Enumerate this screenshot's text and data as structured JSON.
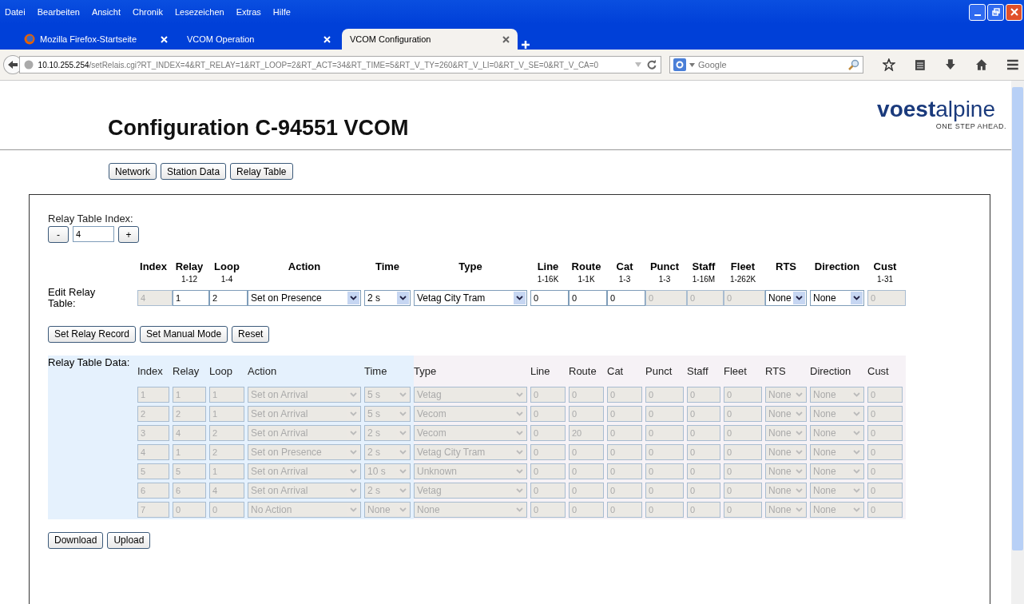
{
  "menu_bar": [
    "Datei",
    "Bearbeiten",
    "Ansicht",
    "Chronik",
    "Lesezeichen",
    "Extras",
    "Hilfe"
  ],
  "tabs": [
    {
      "label": "Mozilla Firefox-Startseite",
      "selected": false,
      "kind": "firefox"
    },
    {
      "label": "VCOM Operation",
      "selected": false,
      "kind": "plain"
    },
    {
      "label": "VCOM Configuration",
      "selected": true,
      "kind": "plain"
    }
  ],
  "address_bar": {
    "host": "10.10.255.254",
    "path": "/setRelais.cgi?RT_INDEX=4&RT_RELAY=1&RT_LOOP=2&RT_ACT=34&RT_TIME=5&RT_V_TY=260&RT_V_LI=0&RT_V_SE=0&RT_V_CA=0"
  },
  "search": {
    "placeholder": "Google"
  },
  "page": {
    "title": "Configuration C-94551 VCOM",
    "logo": {
      "name_bold_part": "voest",
      "name_rest": "alpine",
      "slogan": "ONE STEP AHEAD."
    },
    "nav_buttons": [
      "Network",
      "Station Data",
      "Relay Table"
    ],
    "index_label": "Relay Table Index:",
    "index_minus": "-",
    "index_value": "4",
    "index_plus": "+",
    "columns": [
      {
        "header": "Index",
        "kind": "text"
      },
      {
        "header": "Relay",
        "range": "1-12",
        "kind": "text"
      },
      {
        "header": "Loop",
        "range": "1-4",
        "kind": "text"
      },
      {
        "header": "Action",
        "kind": "select"
      },
      {
        "header": "Time",
        "kind": "select"
      },
      {
        "header": "Type",
        "kind": "select"
      },
      {
        "header": "Line",
        "range": "1-16K",
        "kind": "text"
      },
      {
        "header": "Route",
        "range": "1-1K",
        "kind": "text"
      },
      {
        "header": "Cat",
        "range": "1-3",
        "kind": "text"
      },
      {
        "header": "Punct",
        "range": "1-3",
        "kind": "text"
      },
      {
        "header": "Staff",
        "range": "1-16M",
        "kind": "text"
      },
      {
        "header": "Fleet",
        "range": "1-262K",
        "kind": "text"
      },
      {
        "header": "RTS",
        "kind": "select"
      },
      {
        "header": "Direction",
        "kind": "select"
      },
      {
        "header": "Cust",
        "range": "1-31",
        "kind": "text"
      }
    ],
    "edit_label": "Edit Relay Table:",
    "edit_row": [
      {
        "value": "4",
        "disabled": true
      },
      {
        "value": "1",
        "disabled": false
      },
      {
        "value": "2",
        "disabled": false
      },
      {
        "value": "Set on Presence",
        "disabled": false
      },
      {
        "value": "2 s",
        "disabled": false
      },
      {
        "value": "Vetag City Tram",
        "disabled": false
      },
      {
        "value": "0",
        "disabled": false
      },
      {
        "value": "0",
        "disabled": false
      },
      {
        "value": "0",
        "disabled": false
      },
      {
        "value": "0",
        "disabled": true
      },
      {
        "value": "0",
        "disabled": true
      },
      {
        "value": "0",
        "disabled": true
      },
      {
        "value": "None",
        "disabled": false
      },
      {
        "value": "None",
        "disabled": false
      },
      {
        "value": "0",
        "disabled": true
      }
    ],
    "action_buttons": [
      "Set Relay Record",
      "Set Manual Mode",
      "Reset"
    ],
    "data_label": "Relay Table Data:",
    "data_headers": [
      "Index",
      "Relay",
      "Loop",
      "Action",
      "Time",
      "Type",
      "Line",
      "Route",
      "Cat",
      "Punct",
      "Staff",
      "Fleet",
      "RTS",
      "Direction",
      "Cust"
    ],
    "data_rows": [
      [
        "1",
        "1",
        "1",
        "Set on Arrival",
        "5 s",
        "Vetag",
        "0",
        "0",
        "0",
        "0",
        "0",
        "0",
        "None",
        "None",
        "0"
      ],
      [
        "2",
        "2",
        "1",
        "Set on Arrival",
        "5 s",
        "Vecom",
        "0",
        "0",
        "0",
        "0",
        "0",
        "0",
        "None",
        "None",
        "0"
      ],
      [
        "3",
        "4",
        "2",
        "Set on Arrival",
        "2 s",
        "Vecom",
        "0",
        "20",
        "0",
        "0",
        "0",
        "0",
        "None",
        "None",
        "0"
      ],
      [
        "4",
        "1",
        "2",
        "Set on Presence",
        "2 s",
        "Vetag City Tram",
        "0",
        "0",
        "0",
        "0",
        "0",
        "0",
        "None",
        "None",
        "0"
      ],
      [
        "5",
        "5",
        "1",
        "Set on Arrival",
        "10 s",
        "Unknown",
        "0",
        "0",
        "0",
        "0",
        "0",
        "0",
        "None",
        "None",
        "0"
      ],
      [
        "6",
        "6",
        "4",
        "Set on Arrival",
        "2 s",
        "Vetag",
        "0",
        "0",
        "0",
        "0",
        "0",
        "0",
        "None",
        "None",
        "0"
      ],
      [
        "7",
        "0",
        "0",
        "No Action",
        "None",
        "None",
        "0",
        "0",
        "0",
        "0",
        "0",
        "0",
        "None",
        "None",
        "0"
      ]
    ],
    "data_disabled": true,
    "file_buttons": [
      "Download",
      "Upload"
    ]
  }
}
